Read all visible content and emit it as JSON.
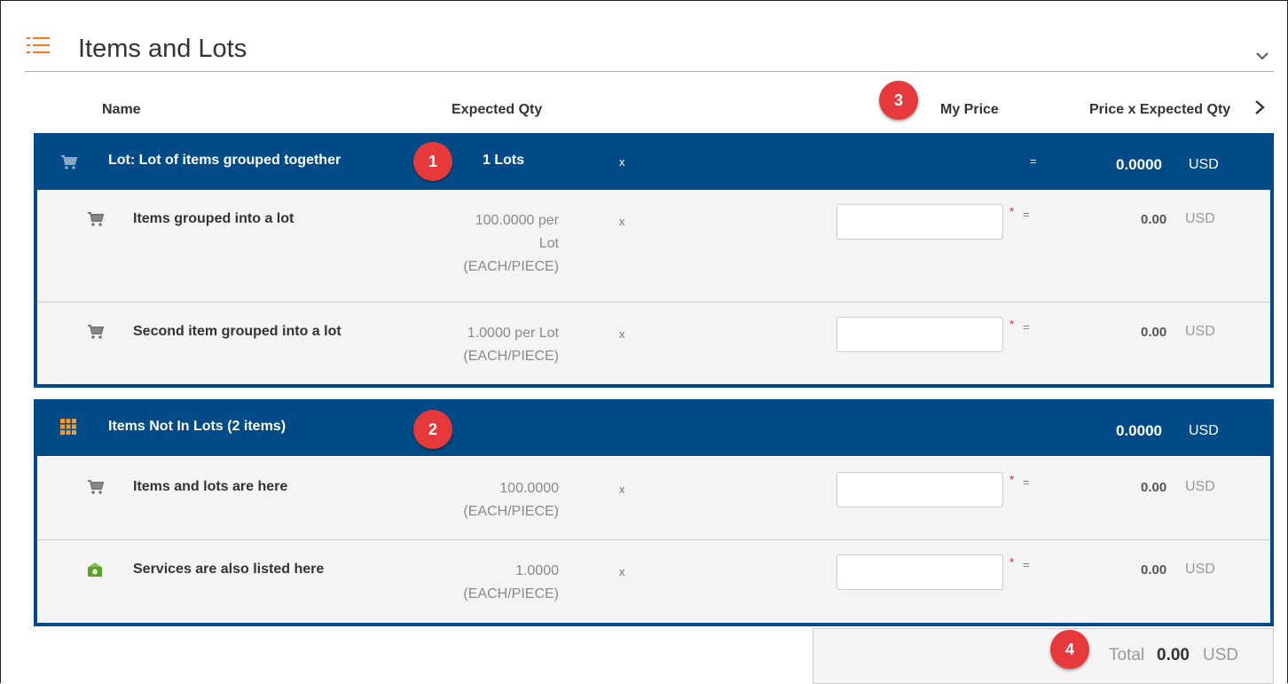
{
  "section": {
    "title": "Items and Lots"
  },
  "columns": {
    "name": "Name",
    "expected_qty": "Expected Qty",
    "my_price": "My Price",
    "price_x_qty": "Price x Expected Qty"
  },
  "badges": [
    "1",
    "2",
    "3",
    "4"
  ],
  "lot_group": {
    "name": "Lot: Lot of items grouped together",
    "qty": "1 Lots",
    "times": "x",
    "equals": "=",
    "total": "0.0000",
    "currency": "USD",
    "items": [
      {
        "icon": "cart-icon",
        "name": "Items grouped into a lot",
        "qty_lines": [
          "100.0000 per",
          "Lot",
          "(EACH/PIECE)"
        ],
        "times": "x",
        "price": "",
        "required": "*",
        "equals": "=",
        "total": "0.00",
        "currency": "USD"
      },
      {
        "icon": "cart-icon",
        "name": "Second item grouped into a lot",
        "qty_lines": [
          "1.0000 per Lot",
          "(EACH/PIECE)"
        ],
        "times": "x",
        "price": "",
        "required": "*",
        "equals": "=",
        "total": "0.00",
        "currency": "USD"
      }
    ]
  },
  "no_lot_group": {
    "name": "Items Not In Lots (2 items)",
    "total": "0.0000",
    "currency": "USD",
    "items": [
      {
        "icon": "cart-icon",
        "name": "Items and lots are here",
        "qty_lines": [
          "100.0000",
          "(EACH/PIECE)"
        ],
        "times": "x",
        "price": "",
        "required": "*",
        "equals": "=",
        "total": "0.00",
        "currency": "USD"
      },
      {
        "icon": "service-icon",
        "name": "Services are also listed here",
        "qty_lines": [
          "1.0000",
          "(EACH/PIECE)"
        ],
        "times": "x",
        "price": "",
        "required": "*",
        "equals": "=",
        "total": "0.00",
        "currency": "USD"
      }
    ]
  },
  "grand_total": {
    "label": "Total",
    "value": "0.00",
    "currency": "USD"
  },
  "colors": {
    "header_blue": "#004b87",
    "accent_orange": "#f07a1c",
    "badge_red": "#e5393b"
  }
}
